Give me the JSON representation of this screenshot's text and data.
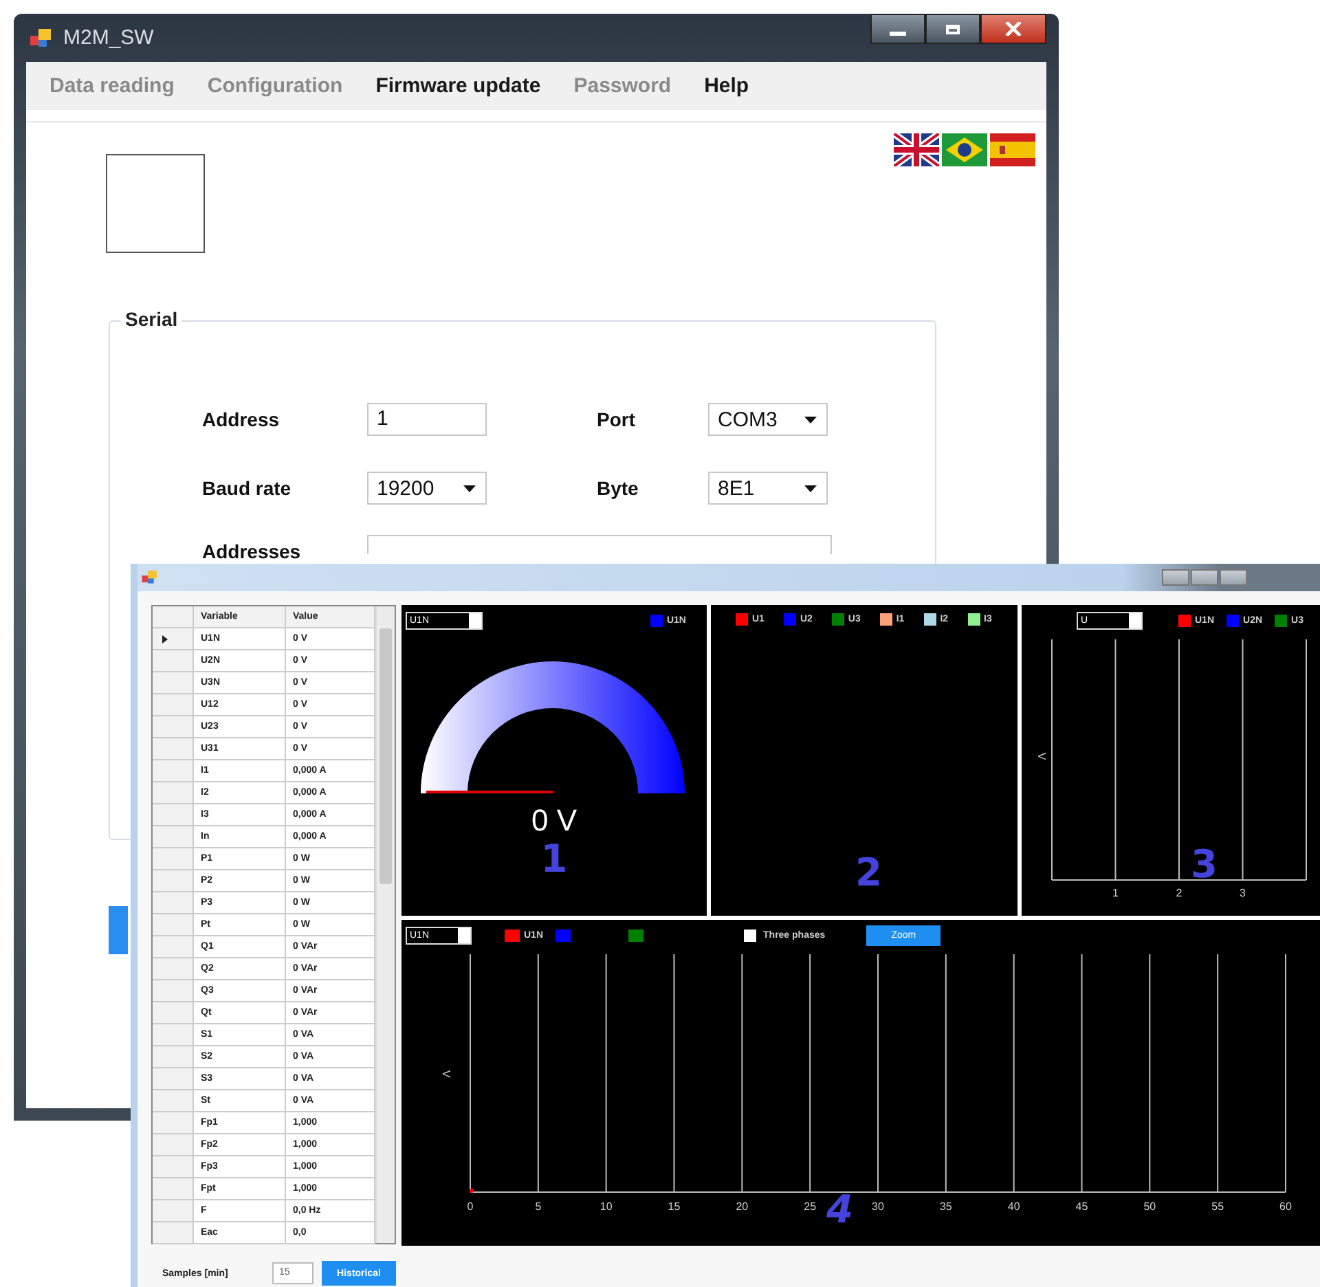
{
  "back_window": {
    "title": "M2M_SW",
    "menu": [
      {
        "label": "Data reading",
        "disabled": true
      },
      {
        "label": "Configuration",
        "disabled": true
      },
      {
        "label": "Firmware update",
        "disabled": false
      },
      {
        "label": "Password",
        "disabled": true
      },
      {
        "label": "Help",
        "disabled": false
      }
    ],
    "serial": {
      "title": "Serial",
      "fields": [
        {
          "label": "Address",
          "kind": "text",
          "value": "1"
        },
        {
          "label": "Port",
          "kind": "dropdown",
          "value": "COM3"
        },
        {
          "label": "Baud rate",
          "kind": "dropdown",
          "value": "19200"
        },
        {
          "label": "Byte",
          "kind": "dropdown",
          "value": "8E1"
        },
        {
          "label": "Addresses",
          "kind": "wide"
        }
      ]
    }
  },
  "front_window": {
    "table": {
      "columns": [
        "Variable",
        "Value"
      ],
      "rows": [
        {
          "variable": "U1N",
          "value": "0 V",
          "selected": true
        },
        {
          "variable": "U2N",
          "value": "0 V",
          "selected": false
        },
        {
          "variable": "U3N",
          "value": "0 V",
          "selected": false
        },
        {
          "variable": "U12",
          "value": "0 V",
          "selected": false
        },
        {
          "variable": "U23",
          "value": "0 V",
          "selected": false
        },
        {
          "variable": "U31",
          "value": "0 V",
          "selected": false
        },
        {
          "variable": "I1",
          "value": "0,000 A",
          "selected": false
        },
        {
          "variable": "I2",
          "value": "0,000 A",
          "selected": false
        },
        {
          "variable": "I3",
          "value": "0,000 A",
          "selected": false
        },
        {
          "variable": "In",
          "value": "0,000 A",
          "selected": false
        },
        {
          "variable": "P1",
          "value": "0 W",
          "selected": false
        },
        {
          "variable": "P2",
          "value": "0 W",
          "selected": false
        },
        {
          "variable": "P3",
          "value": "0 W",
          "selected": false
        },
        {
          "variable": "Pt",
          "value": "0 W",
          "selected": false
        },
        {
          "variable": "Q1",
          "value": "0 VAr",
          "selected": false
        },
        {
          "variable": "Q2",
          "value": "0 VAr",
          "selected": false
        },
        {
          "variable": "Q3",
          "value": "0 VAr",
          "selected": false
        },
        {
          "variable": "Qt",
          "value": "0 VAr",
          "selected": false
        },
        {
          "variable": "S1",
          "value": "0 VA",
          "selected": false
        },
        {
          "variable": "S2",
          "value": "0 VA",
          "selected": false
        },
        {
          "variable": "S3",
          "value": "0 VA",
          "selected": false
        },
        {
          "variable": "St",
          "value": "0 VA",
          "selected": false
        },
        {
          "variable": "Fp1",
          "value": "1,000",
          "selected": false
        },
        {
          "variable": "Fp2",
          "value": "1,000",
          "selected": false
        },
        {
          "variable": "Fp3",
          "value": "1,000",
          "selected": false
        },
        {
          "variable": "Fpt",
          "value": "1,000",
          "selected": false
        },
        {
          "variable": "F",
          "value": "0,0 Hz",
          "selected": false
        },
        {
          "variable": "Eac",
          "value": "0,0",
          "selected": false
        }
      ]
    },
    "samples": {
      "label": "Samples [min]",
      "value": "15"
    },
    "historical_button": "Historical",
    "gauge_panel": {
      "selector": "U1N",
      "legend": [
        {
          "label": "U1N",
          "color": "#0000ff"
        }
      ],
      "reading": "0 V",
      "marker": "1"
    },
    "phasor_panel": {
      "legend": [
        {
          "label": "U1",
          "color": "#ff0000"
        },
        {
          "label": "U2",
          "color": "#0000ff"
        },
        {
          "label": "U3",
          "color": "#008000"
        },
        {
          "label": "I1",
          "color": "#ffa07a"
        },
        {
          "label": "I2",
          "color": "#add8e6"
        },
        {
          "label": "I3",
          "color": "#90ee90"
        }
      ],
      "marker": "2"
    },
    "bar_panel": {
      "selector": "U",
      "legend": [
        {
          "label": "U1N",
          "color": "#ff0000"
        },
        {
          "label": "U2N",
          "color": "#0000ff"
        },
        {
          "label": "U3",
          "color": "#008000"
        }
      ],
      "axis_label": "V",
      "x_labels": [
        "1",
        "2",
        "3"
      ],
      "marker": "3"
    },
    "trend_panel": {
      "selector": "U1N",
      "legend": [
        {
          "label": "U1N",
          "color": "#ff0000"
        },
        {
          "color": "#0000ff"
        },
        {
          "color": "#008000"
        }
      ],
      "three_phases": {
        "label": "Three phases",
        "checked": false
      },
      "zoom_button": "Zoom",
      "axis_label": "V",
      "x_labels": [
        "0",
        "5",
        "10",
        "15",
        "20",
        "25",
        "30",
        "35",
        "40",
        "45",
        "50",
        "55",
        "60"
      ],
      "marker": "4"
    }
  }
}
